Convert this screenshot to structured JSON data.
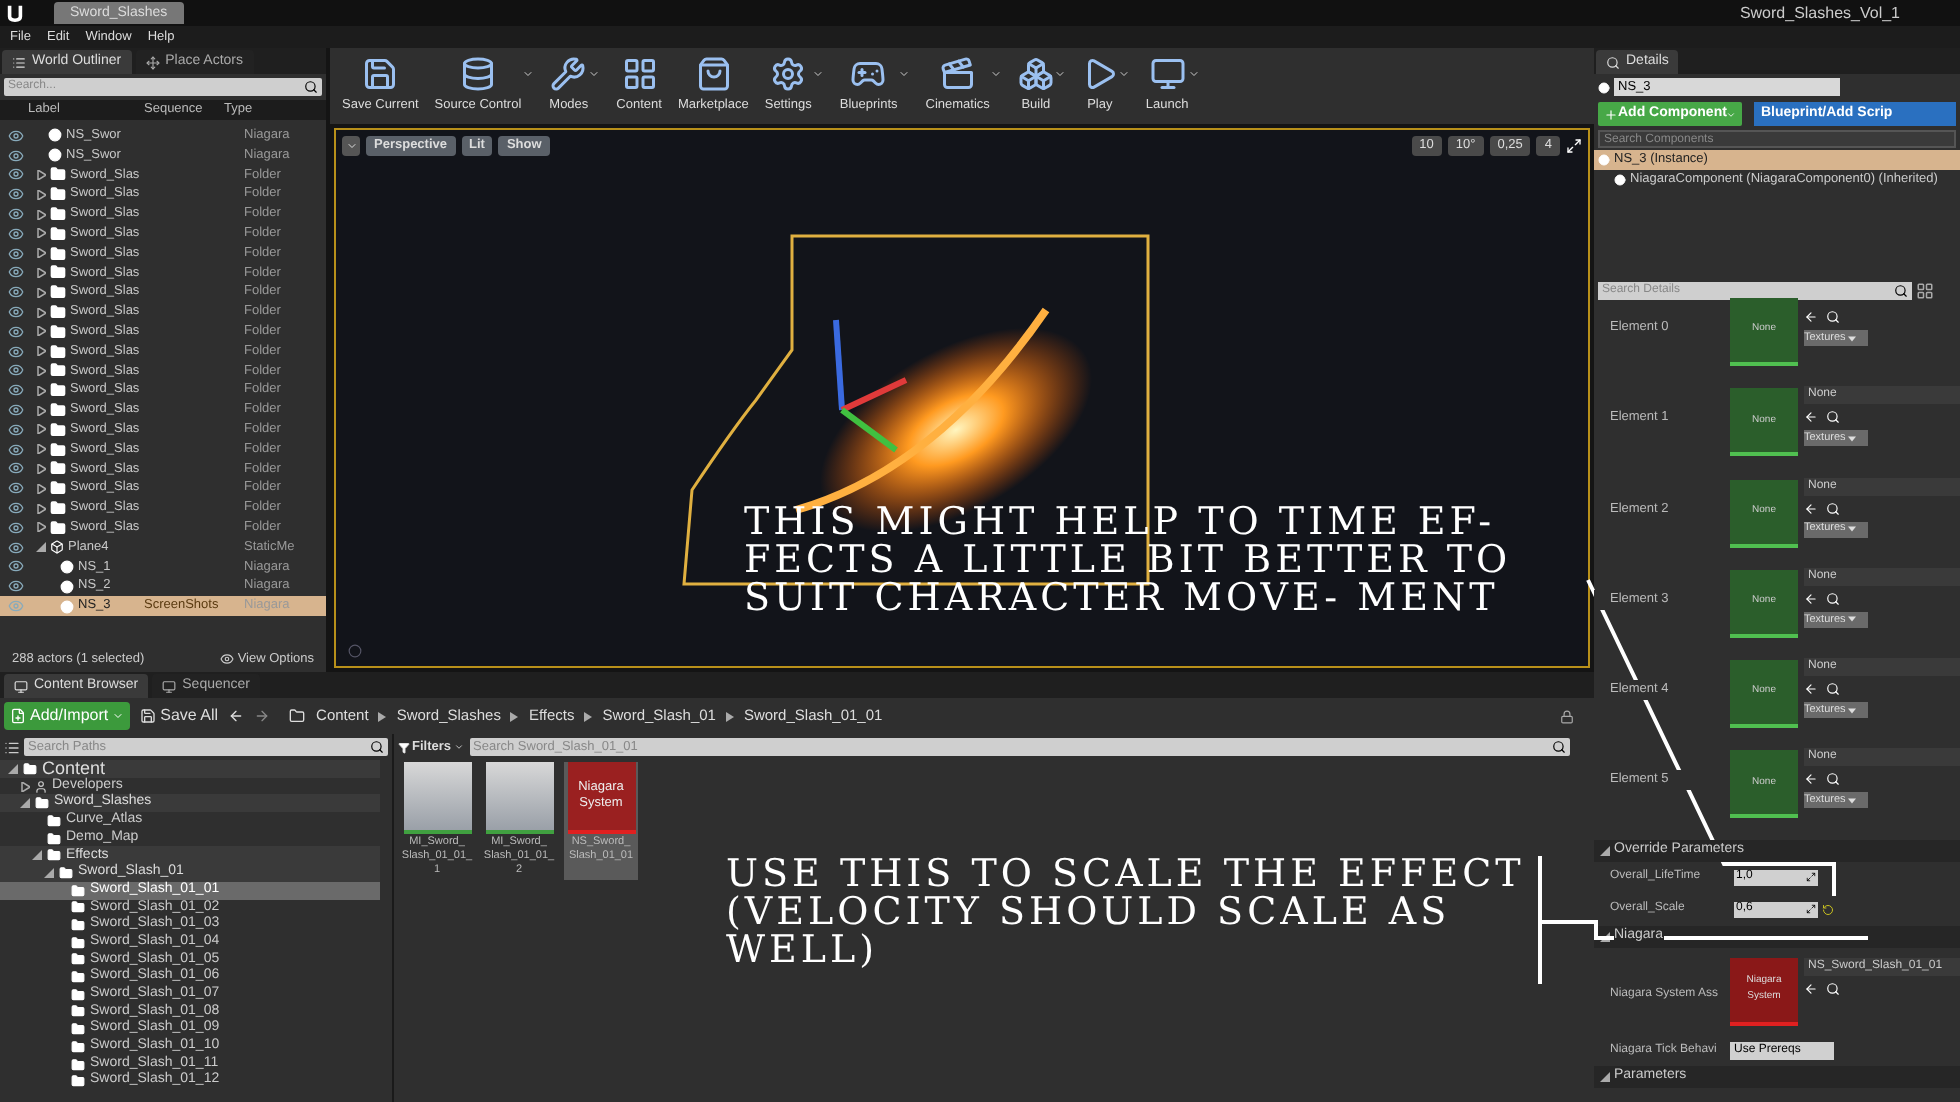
{
  "title_bar": {
    "tab": "Sword_Slashes",
    "project": "Sword_Slashes_Vol_1"
  },
  "menu": [
    "File",
    "Edit",
    "Window",
    "Help"
  ],
  "outliner_tabs": [
    {
      "label": "World Outliner",
      "selected": true
    },
    {
      "label": "Place Actors",
      "selected": false
    }
  ],
  "outliner": {
    "search_placeholder": "Search...",
    "columns": [
      "Label",
      "Sequence",
      "Type"
    ],
    "rows": [
      {
        "kind": "actor",
        "label": "NS_Swor",
        "type": "Niagara",
        "selected": false
      },
      {
        "kind": "actor",
        "label": "NS_Swor",
        "type": "Niagara",
        "selected": false
      },
      {
        "kind": "folder",
        "label": "Sword_Slas",
        "type": "Folder",
        "selected": false
      },
      {
        "kind": "folder",
        "label": "Sword_Slas",
        "type": "Folder",
        "selected": false
      },
      {
        "kind": "folder",
        "label": "Sword_Slas",
        "type": "Folder",
        "selected": false
      },
      {
        "kind": "folder",
        "label": "Sword_Slas",
        "type": "Folder",
        "selected": false
      },
      {
        "kind": "folder",
        "label": "Sword_Slas",
        "type": "Folder",
        "selected": false
      },
      {
        "kind": "folder",
        "label": "Sword_Slas",
        "type": "Folder",
        "selected": false
      },
      {
        "kind": "folder",
        "label": "Sword_Slas",
        "type": "Folder",
        "selected": false
      },
      {
        "kind": "folder",
        "label": "Sword_Slas",
        "type": "Folder",
        "selected": false
      },
      {
        "kind": "folder",
        "label": "Sword_Slas",
        "type": "Folder",
        "selected": false
      },
      {
        "kind": "folder",
        "label": "Sword_Slas",
        "type": "Folder",
        "selected": false
      },
      {
        "kind": "folder",
        "label": "Sword_Slas",
        "type": "Folder",
        "selected": false
      },
      {
        "kind": "folder",
        "label": "Sword_Slas",
        "type": "Folder",
        "selected": false
      },
      {
        "kind": "folder",
        "label": "Sword_Slas",
        "type": "Folder",
        "selected": false
      },
      {
        "kind": "folder",
        "label": "Sword_Slas",
        "type": "Folder",
        "selected": false
      },
      {
        "kind": "folder",
        "label": "Sword_Slas",
        "type": "Folder",
        "selected": false
      },
      {
        "kind": "folder",
        "label": "Sword_Slas",
        "type": "Folder",
        "selected": false
      },
      {
        "kind": "folder",
        "label": "Sword_Slas",
        "type": "Folder",
        "selected": false
      },
      {
        "kind": "folder",
        "label": "Sword_Slas",
        "type": "Folder",
        "selected": false
      },
      {
        "kind": "folder",
        "label": "Sword_Slas",
        "type": "Folder",
        "selected": false
      },
      {
        "kind": "mesh",
        "label": "Plane4",
        "type": "StaticMe",
        "selected": false,
        "expanded": true,
        "children": [
          {
            "kind": "actor",
            "label": "NS_1",
            "type": "Niagara",
            "selected": false
          },
          {
            "kind": "actor",
            "label": "NS_2",
            "type": "Niagara",
            "selected": false
          },
          {
            "kind": "actor",
            "label": "NS_3",
            "sequence": "ScreenShots",
            "type": "Niagara",
            "selected": true
          }
        ]
      }
    ],
    "status": "288 actors (1 selected)",
    "view_options": "View Options"
  },
  "toolbar": [
    {
      "label": "Save Current",
      "dropdown": false
    },
    {
      "label": "Source Control",
      "dropdown": true
    },
    {
      "label": "Modes",
      "dropdown": true
    },
    {
      "label": "Content",
      "dropdown": false
    },
    {
      "label": "Marketplace",
      "dropdown": false
    },
    {
      "label": "Settings",
      "dropdown": true
    },
    {
      "label": "Blueprints",
      "dropdown": true
    },
    {
      "label": "Cinematics",
      "dropdown": true
    },
    {
      "label": "Build",
      "dropdown": true
    },
    {
      "label": "Play",
      "dropdown": true
    },
    {
      "label": "Launch",
      "dropdown": true
    }
  ],
  "viewport": {
    "buttons": [
      "Perspective",
      "Lit",
      "Show"
    ],
    "snaps": [
      "10",
      "10°",
      "0,25",
      "4"
    ],
    "note": "THIS MIGHT HELP TO TIME EF- FECTS A LITTLE BIT BETTER TO SUIT CHARACTER MOVE- MENT"
  },
  "content_tabs": [
    {
      "label": "Content Browser",
      "selected": true
    },
    {
      "label": "Sequencer",
      "selected": false
    }
  ],
  "content": {
    "add_import": "Add/Import",
    "save_all": "Save All",
    "path": [
      "Content",
      "Sword_Slashes",
      "Effects",
      "Sword_Slash_01",
      "Sword_Slash_01_01"
    ],
    "search_paths_placeholder": "Search Paths",
    "tree": [
      {
        "label": "Content",
        "expanded": true,
        "selected": false,
        "children": [
          {
            "label": "Developers",
            "kind": "user",
            "expanded": false,
            "selected": false
          },
          {
            "label": "Sword_Slashes",
            "expanded": true,
            "selected": false,
            "children": [
              {
                "label": "Curve_Atlas",
                "selected": false
              },
              {
                "label": "Demo_Map",
                "selected": false
              },
              {
                "label": "Effects",
                "expanded": true,
                "selected": false,
                "children": [
                  {
                    "label": "Sword_Slash_01",
                    "expanded": true,
                    "selected": false,
                    "children": [
                      {
                        "label": "Sword_Slash_01_01",
                        "selected": true
                      },
                      {
                        "label": "Sword_Slash_01_02",
                        "selected": false
                      },
                      {
                        "label": "Sword_Slash_01_03",
                        "selected": false
                      },
                      {
                        "label": "Sword_Slash_01_04",
                        "selected": false
                      },
                      {
                        "label": "Sword_Slash_01_05",
                        "selected": false
                      },
                      {
                        "label": "Sword_Slash_01_06",
                        "selected": false
                      },
                      {
                        "label": "Sword_Slash_01_07",
                        "selected": false
                      },
                      {
                        "label": "Sword_Slash_01_08",
                        "selected": false
                      },
                      {
                        "label": "Sword_Slash_01_09",
                        "selected": false
                      },
                      {
                        "label": "Sword_Slash_01_10",
                        "selected": false
                      },
                      {
                        "label": "Sword_Slash_01_11",
                        "selected": false
                      },
                      {
                        "label": "Sword_Slash_01_12",
                        "selected": false
                      }
                    ]
                  }
                ]
              }
            ]
          }
        ]
      }
    ],
    "filters": "Filters",
    "search_placeholder": "Search Sword_Slash_01_01",
    "assets": [
      {
        "kind": "material",
        "name": "MI_Sword_ Slash_01_01_ 1",
        "selected": false
      },
      {
        "kind": "material",
        "name": "MI_Sword_ Slash_01_01_ 2",
        "selected": false
      },
      {
        "kind": "niagara",
        "thumb": "Niagara System",
        "name": "NS_Sword_ Slash_01_01",
        "selected": true
      }
    ],
    "note": "USE THIS TO SCALE THE EFFECT (VELOCITY SHOULD SCALE AS WELL)"
  },
  "details": {
    "tab": "Details",
    "name": "NS_3",
    "add_component": "Add Component",
    "blueprint": "Blueprint/Add Scrip",
    "search_components_placeholder": "Search Components",
    "components": [
      {
        "label": "NS_3 (Instance)",
        "selected": true
      },
      {
        "label": "NiagaraComponent (NiagaraComponent0) (Inherited)",
        "selected": false
      }
    ],
    "search_details_placeholder": "Search Details",
    "elements": [
      {
        "label": "Element 0",
        "thumb": "None",
        "button": "Textures"
      },
      {
        "label": "Element 1",
        "thumb": "None",
        "value": "None",
        "button": "Textures"
      },
      {
        "label": "Element 2",
        "thumb": "None",
        "value": "None",
        "button": "Textures"
      },
      {
        "label": "Element 3",
        "thumb": "None",
        "value": "None",
        "button": "Textures"
      },
      {
        "label": "Element 4",
        "thumb": "None",
        "value": "None",
        "button": "Textures"
      },
      {
        "label": "Element 5",
        "thumb": "None",
        "value": "None",
        "button": "Textures"
      }
    ],
    "override": {
      "title": "Override Parameters",
      "expanded": true,
      "params": [
        {
          "label": "Overall_LifeTime",
          "value": "1,0",
          "modified": false
        },
        {
          "label": "Overall_Scale",
          "value": "0,6",
          "modified": true
        }
      ]
    },
    "niagara": {
      "title": "Niagara",
      "expanded": true,
      "asset_label": "Niagara System Ass",
      "thumb": "Niagara System",
      "asset": "NS_Sword_Slash_01_01",
      "tick_label": "Niagara Tick Behavi",
      "tick": "Use Prereqs"
    },
    "parameters": {
      "title": "Parameters",
      "expanded": true
    }
  }
}
